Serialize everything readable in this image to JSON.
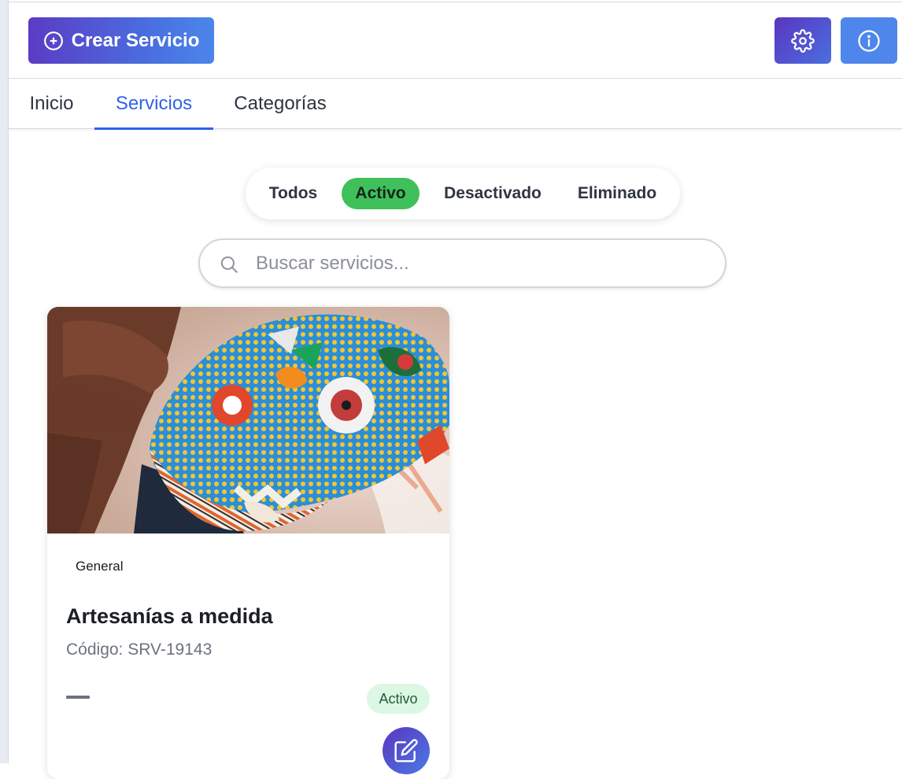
{
  "toolbar": {
    "create_label": "Crear Servicio"
  },
  "nav": {
    "tabs": [
      {
        "label": "Inicio"
      },
      {
        "label": "Servicios"
      },
      {
        "label": "Categorías"
      }
    ],
    "active_tab": "Servicios"
  },
  "filters": {
    "options": [
      {
        "label": "Todos"
      },
      {
        "label": "Activo"
      },
      {
        "label": "Desactivado"
      },
      {
        "label": "Eliminado"
      }
    ],
    "active": "Activo"
  },
  "search": {
    "placeholder": "Buscar servicios..."
  },
  "services": [
    {
      "category": "General",
      "title": "Artesanías a medida",
      "code": "Código: SRV-19143",
      "price": "—",
      "status": "Activo"
    }
  ],
  "icons": {
    "create": "plus-circle-icon",
    "settings": "gear-icon",
    "info": "info-icon",
    "search": "search-icon",
    "edit": "edit-icon"
  },
  "colors": {
    "accent": "#2f63e6",
    "active_filter": "#3fc05b",
    "status_badge_bg": "#dcf7e4",
    "status_badge_text": "#1e5e36",
    "button_gradient_start": "#5b3cc4",
    "button_gradient_end": "#4b86ea"
  }
}
